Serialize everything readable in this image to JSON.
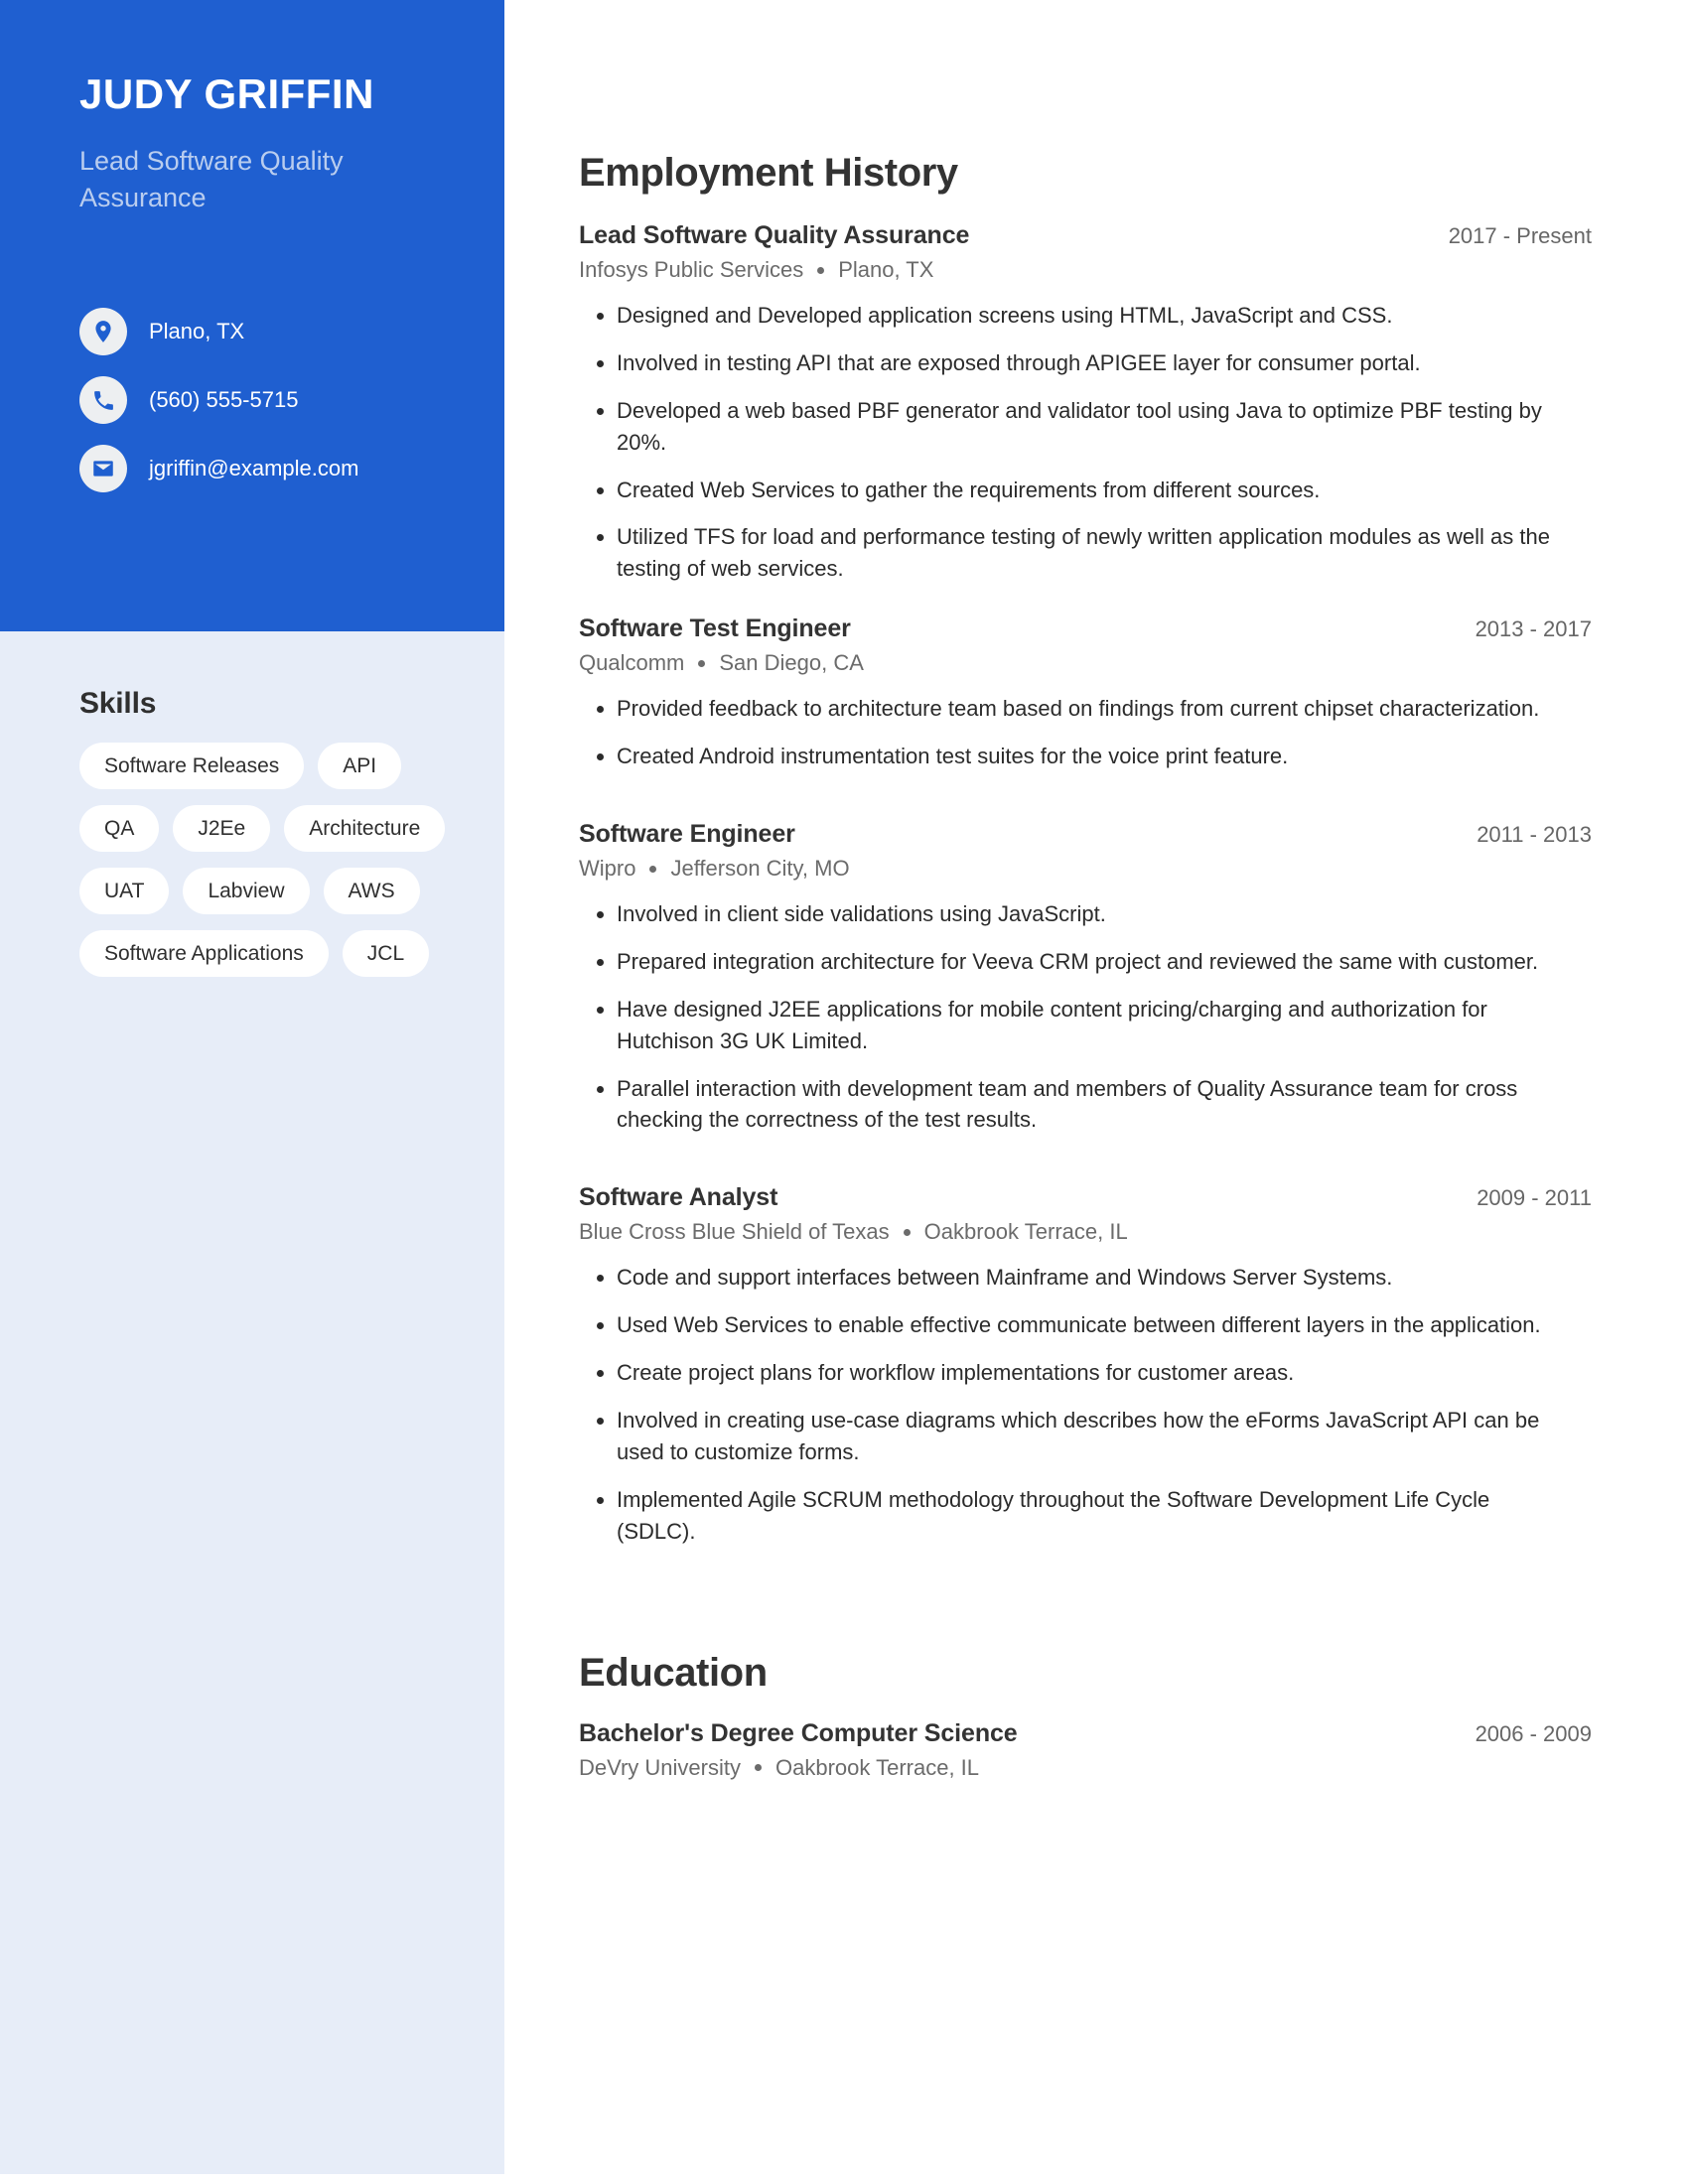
{
  "profile": {
    "name": "JUDY GRIFFIN",
    "headline": "Lead Software Quality Assurance",
    "contacts": [
      {
        "icon": "location-pin-icon",
        "value": "Plano, TX"
      },
      {
        "icon": "phone-icon",
        "value": "(560) 555-5715"
      },
      {
        "icon": "envelope-icon",
        "value": "jgriffin@example.com"
      }
    ]
  },
  "skills": {
    "title": "Skills",
    "items": [
      "Software Releases",
      "API",
      "QA",
      "J2Ee",
      "Architecture",
      "UAT",
      "Labview",
      "AWS",
      "Software Applications",
      "JCL"
    ]
  },
  "employment": {
    "title": "Employment History",
    "entries": [
      {
        "role": "Lead Software Quality Assurance",
        "dates": "2017 - Present",
        "company": "Infosys Public Services",
        "location": "Plano, TX",
        "bullets": [
          "Designed and Developed application screens using HTML, JavaScript and CSS.",
          "Involved in testing API that are exposed through APIGEE layer for consumer portal.",
          "Developed a web based PBF generator and validator tool using Java to optimize PBF testing by 20%.",
          "Created Web Services to gather the requirements from different sources.",
          "Utilized TFS for load and performance testing of newly written application modules as well as the testing of web services."
        ]
      },
      {
        "role": "Software Test Engineer",
        "dates": "2013 - 2017",
        "company": "Qualcomm",
        "location": "San Diego, CA",
        "bullets": [
          "Provided feedback to architecture team based on findings from current chipset characterization.",
          "Created Android instrumentation test suites for the voice print feature."
        ]
      },
      {
        "role": "Software Engineer",
        "dates": "2011 - 2013",
        "company": "Wipro",
        "location": "Jefferson City, MO",
        "bullets": [
          "Involved in client side validations using JavaScript.",
          "Prepared integration architecture for Veeva CRM project and reviewed the same with customer.",
          "Have designed J2EE applications for mobile content pricing/charging and authorization for Hutchison 3G UK Limited.",
          "Parallel interaction with development team and members of Quality Assurance team for cross checking the correctness of the test results."
        ]
      },
      {
        "role": "Software Analyst",
        "dates": "2009 - 2011",
        "company": "Blue Cross Blue Shield of Texas",
        "location": "Oakbrook Terrace, IL",
        "bullets": [
          "Code and support interfaces between Mainframe and Windows Server Systems.",
          "Used Web Services to enable effective communicate between different layers in the application.",
          "Create project plans for workflow implementations for customer areas.",
          "Involved in creating use-case diagrams which describes how the eForms JavaScript API can be used to customize forms.",
          "Implemented Agile SCRUM methodology throughout the Software Development Life Cycle (SDLC)."
        ]
      }
    ]
  },
  "education": {
    "title": "Education",
    "entries": [
      {
        "degree": "Bachelor's Degree Computer Science",
        "dates": "2006 - 2009",
        "school": "DeVry University",
        "location": "Oakbrook Terrace, IL"
      }
    ]
  },
  "theme": {
    "accent": "#1f5fd0",
    "sidebar_bg": "#e7edf8",
    "heading_color": "#333333",
    "muted_color": "#666666"
  }
}
